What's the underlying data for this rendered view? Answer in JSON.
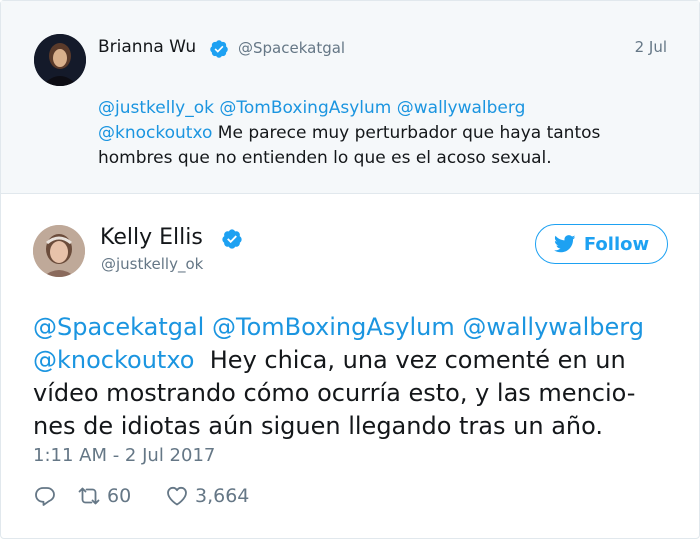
{
  "parent_tweet": {
    "author_name": "Brianna Wu",
    "author_handle": "@Spacekatgal",
    "date": "2 Jul",
    "mentions": [
      "@justkelly_ok",
      "@TomBoxingAsylum",
      "@wallywalberg",
      "@knockoutxo"
    ],
    "text": "Me parece muy perturbador que haya tantos hombres que no entienden lo que es el acoso sexual."
  },
  "main_tweet": {
    "author_name": "Kelly Ellis",
    "author_handle": "@justkelly_ok",
    "follow_label": "Follow",
    "mentions": [
      "@Spacekatgal",
      "@TomBoxingAsylum",
      "@wallywalberg",
      "@knockoutxo"
    ],
    "text": "Hey chica, una vez comenté en un vídeo mostrando cómo ocurría esto, y las mencio-nes de idiotas aún siguen llegando tras un año.",
    "text_line1": "Hey chica, una vez comenté en un",
    "text_line2": "vídeo mostrando cómo ocurría esto, y las mencio-",
    "text_line3": "nes de idiotas aún siguen llegando tras un año.",
    "timestamp": "1:11 AM - 2 Jul 2017",
    "retweet_count": "60",
    "like_count": "3,664"
  },
  "colors": {
    "accent": "#1da1f2",
    "mention": "#1b95e0",
    "muted": "#657786",
    "parent_bg": "#f5f8fa"
  },
  "icons": [
    "verified-badge-icon",
    "twitter-bird-icon",
    "reply-icon",
    "retweet-icon",
    "heart-icon"
  ]
}
